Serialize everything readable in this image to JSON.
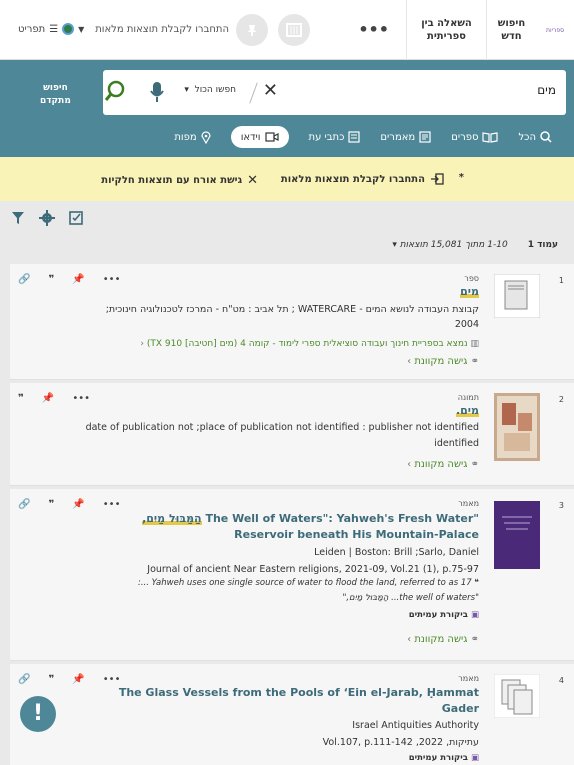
{
  "header": {
    "logo_text": "ספריות",
    "new_search": "חיפוש חדש",
    "ill": [
      "השאלה בין",
      "ספריתית"
    ],
    "more": "•••",
    "login": "התחברו לקבלת תוצאות מלאות",
    "menu": "תפריט"
  },
  "search": {
    "query": "מים",
    "scope": "חפשו הכול",
    "advanced": [
      "חיפוש",
      "מתקדם"
    ]
  },
  "tabs": [
    {
      "label": "הכל"
    },
    {
      "label": "ספרים"
    },
    {
      "label": "מאמרים"
    },
    {
      "label": "כתבי עת"
    },
    {
      "label": "וידאו"
    },
    {
      "label": "מפות"
    }
  ],
  "notice": {
    "login": "התחברו לקבלת תוצאות מלאות",
    "guest": "גישת אורח עם תוצאות חלקיות",
    "star": "*"
  },
  "pager": {
    "page": "עמוד 1",
    "count": "1-10 מתוך 15,081 תוצאות"
  },
  "results": [
    {
      "num": "1",
      "type": "ספר",
      "title": "מים",
      "lines": [
        "קבוצת העבודה לנושא המים - WATERCARE ; תל אביב : מט\"ח - המרכז לטכנולוגיה חינוכית;",
        "2004"
      ],
      "location": "נמצא בספריית חינוך ועבודה סוציאלית   ספרי לימוד - קומה 4   (מים [חטיבה] TX 910)",
      "access": "גישה מקוונת"
    },
    {
      "num": "2",
      "type": "תמונה",
      "title": "מים.",
      "lines": [
        "date of publication not ;place of publication not identified : publisher not identified",
        "identified"
      ],
      "access": "גישה מקוונת"
    },
    {
      "num": "3",
      "type": "מאמר",
      "title_he": "הַמַּבּוּל מַיִם,",
      "title_en": "\"The Well of Waters\": Yahweh's Fresh Water",
      "title_en2": "Reservoir beneath His Mountain-Palace",
      "lines": [
        "Leiden | Boston: Brill ;Sarlo, Daniel",
        "Journal of ancient Near Eastern religions, 2021-09, Vol.21 (1), p.75-97",
        "17 Yahweh uses one single source of water to flood the land, referred to as ...:",
        "\"the well of waters... הַמַּבּוּל מַיִם,\""
      ],
      "peer": "ביקורת עמיתים",
      "access": "גישה מקוונת"
    },
    {
      "num": "4",
      "type": "מאמר",
      "title_en": "The Glass Vessels from the Pools of ‘Ein el-Jarab, Ḥammat",
      "title_en2": "Gader",
      "lines": [
        "Israel Antiquities Authority",
        "עתיקות, 2022, Vol.107, p.111-142"
      ],
      "peer": "ביקורת עמיתים"
    }
  ],
  "colors": {
    "accent": "#4e8797",
    "notice": "#faf3b8",
    "link": "#3d6b79",
    "green": "#4c8a2a"
  }
}
